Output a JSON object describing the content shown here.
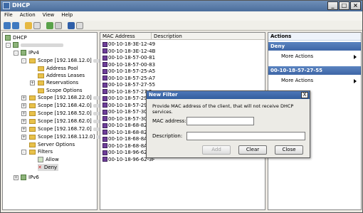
{
  "window": {
    "title": "DHCP"
  },
  "menu": [
    "File",
    "Action",
    "View",
    "Help"
  ],
  "tree": {
    "root": "DHCP",
    "ipv4": "IPv4",
    "scope_main": "Scope [192.168.12.0]",
    "children": [
      "Address Pool",
      "Address Leases",
      "Reservations",
      "Scope Options"
    ],
    "scopes": [
      "Scope [192.168.22.0]",
      "Scope [192.168.42.0]",
      "Scope [192.168.52.0]",
      "Scope [192.168.62.0]",
      "Scope [192.168.72.0]",
      "Scope [192.168.112.0]"
    ],
    "server_options": "Server Options",
    "filters": "Filters",
    "allow": "Allow",
    "deny": "Deny",
    "ipv6": "IPv6"
  },
  "list": {
    "col_mac": "MAC Address",
    "col_desc": "Description",
    "rows": [
      "00-10-18-3E-12-49",
      "00-10-18-3E-12-4B",
      "00-10-18-57-00-81",
      "00-10-18-57-00-83",
      "00-10-18-57-25-A5",
      "00-10-18-57-25-A7",
      "00-10-18-57-27-55",
      "00-10-18-57-27-5",
      "00-10-18-57-29-2",
      "00-10-18-57-29-2",
      "00-10-18-57-3C-3",
      "00-10-18-57-3C-3",
      "00-10-18-68-82-3",
      "00-10-18-68-82-3",
      "00-10-18-68-8A-F",
      "00-10-18-68-8A-F",
      "00-10-18-96-62-3D",
      "00-10-18-96-62-3F"
    ]
  },
  "actions": {
    "header": "Actions",
    "section1": "Deny",
    "section1_item": "More Actions",
    "section2": "00-10-18-57-27-55",
    "section2_item": "More Actions"
  },
  "dialog": {
    "title": "New Filter",
    "close": "X",
    "text": "Provide MAC address of the client, that will not receive DHCP services.",
    "mac_label": "MAC address:",
    "desc_label": "Description:",
    "mac_value": "",
    "desc_value": "",
    "add": "Add",
    "clear": "Clear",
    "close_btn": "Close"
  },
  "colors": {
    "title_bar": "#4a6d9b",
    "selection": "#3e66a6",
    "folder": "#e8c14a"
  }
}
